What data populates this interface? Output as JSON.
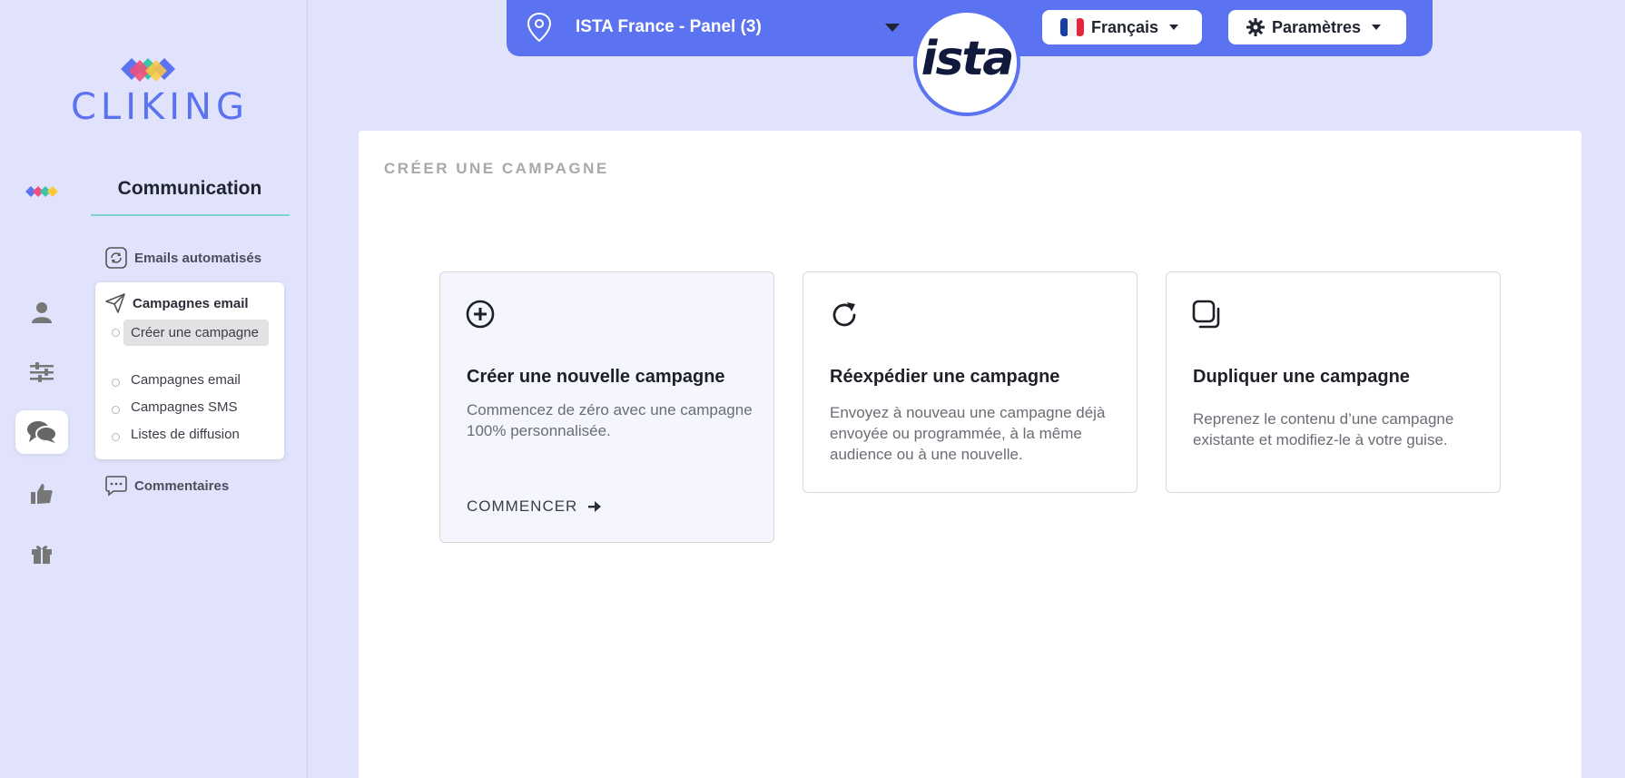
{
  "sidebar": {
    "logo_text": "CLIKING",
    "section_title": "Communication",
    "menu": {
      "auto_emails": "Emails automatisés",
      "campaigns_group": "Campagnes email",
      "sub_items": [
        {
          "label": "Créer une campagne",
          "active": true
        },
        {
          "label": "Campagnes email",
          "active": false
        },
        {
          "label": "Campagnes SMS",
          "active": false
        },
        {
          "label": "Listes de diffusion",
          "active": false
        }
      ],
      "comments": "Commentaires"
    },
    "rail_icons": [
      "cliking-logo-icon",
      "user-icon",
      "sliders-icon",
      "chat-icon",
      "thumbs-up-icon",
      "gift-icon"
    ],
    "active_rail_icon": "chat-icon"
  },
  "topbar": {
    "panel_name": "ISTA France - Panel (3)",
    "brand_logo": "ista",
    "language": "Français",
    "settings": "Paramètres"
  },
  "main": {
    "title": "CRÉER UNE CAMPAGNE",
    "options": [
      {
        "icon": "plus-circle-icon",
        "name": "Créer une nouvelle campagne",
        "description": "Commencez de zéro avec une campagne 100% personnalisée.",
        "cta": "COMMENCER"
      },
      {
        "icon": "refresh-icon",
        "name": "Réexpédier une campagne",
        "description": "Envoyez à nouveau une campagne déjà envoyée ou programmée, à la même audience ou à une nouvelle."
      },
      {
        "icon": "duplicate-icon",
        "name": "Dupliquer une campagne",
        "description": "Reprenez le contenu d’une campagne existante et modifiez-le à votre guise."
      }
    ]
  },
  "colors": {
    "background": "#e0e3fb",
    "accent": "#5b73f0",
    "underline": "#7fd3d7"
  }
}
